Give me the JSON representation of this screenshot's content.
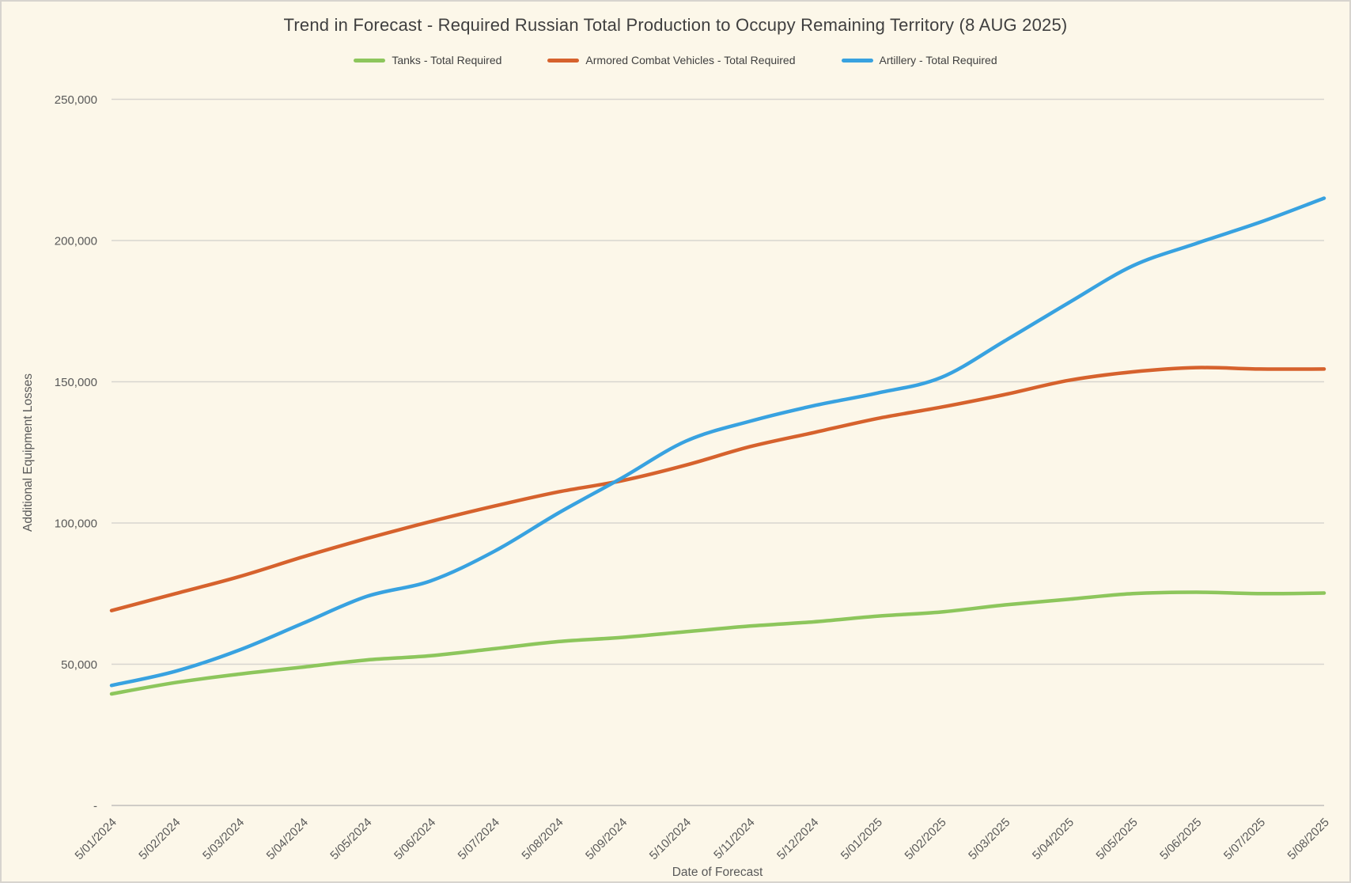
{
  "page": {
    "background_color": "#FCF7E9",
    "border_color": "#D7D4CE",
    "gridline_color": "#D8D5CF",
    "axisline_color": "#C9C6C0"
  },
  "chart": {
    "title": "Trend in Forecast - Required Russian Total Production to Occupy Remaining Territory (8 AUG 2025)",
    "y_axis_title": "Additional Equipment Losses",
    "x_axis_title": "Date of Forecast",
    "y_tick_labels": [
      "-",
      "50,000",
      "100,000",
      "150,000",
      "200,000",
      "250,000"
    ]
  },
  "chart_data": {
    "type": "line",
    "title": "Trend in Forecast - Required Russian Total Production to Occupy Remaining Territory (8 AUG 2025)",
    "xlabel": "Date of Forecast",
    "ylabel": "Additional Equipment Losses",
    "ylim": [
      0,
      250000
    ],
    "y_ticks": [
      0,
      50000,
      100000,
      150000,
      200000,
      250000
    ],
    "grid": "horizontal-only",
    "legend_position": "top",
    "categories": [
      "5/01/2024",
      "5/02/2024",
      "5/03/2024",
      "5/04/2024",
      "5/05/2024",
      "5/06/2024",
      "5/07/2024",
      "5/08/2024",
      "5/09/2024",
      "5/10/2024",
      "5/11/2024",
      "5/12/2024",
      "5/01/2025",
      "5/02/2025",
      "5/03/2025",
      "5/04/2025",
      "5/05/2025",
      "5/06/2025",
      "5/07/2025",
      "5/08/2025"
    ],
    "series": [
      {
        "id": "tanks",
        "name": "Tanks - Total Required",
        "color": "#8DC65C",
        "values": [
          39500,
          43500,
          46500,
          49000,
          51500,
          53000,
          55500,
          58000,
          59500,
          61500,
          63500,
          65000,
          67000,
          68500,
          71000,
          73000,
          75000,
          75500,
          75000,
          75200
        ]
      },
      {
        "id": "acv",
        "name": "Armored Combat Vehicles - Total Required",
        "color": "#D6622D",
        "values": [
          69000,
          75000,
          81000,
          88000,
          94500,
          100500,
          106000,
          111000,
          115000,
          120500,
          127000,
          132000,
          137000,
          141000,
          145500,
          150500,
          153500,
          155000,
          154500,
          154500
        ]
      },
      {
        "id": "artillery",
        "name": "Artillery - Total Required",
        "color": "#38A2E0",
        "values": [
          42500,
          47500,
          55000,
          64500,
          74000,
          79500,
          90000,
          103500,
          116000,
          129000,
          136000,
          141500,
          146000,
          151500,
          164500,
          178000,
          191000,
          199000,
          206500,
          215000
        ]
      }
    ]
  }
}
